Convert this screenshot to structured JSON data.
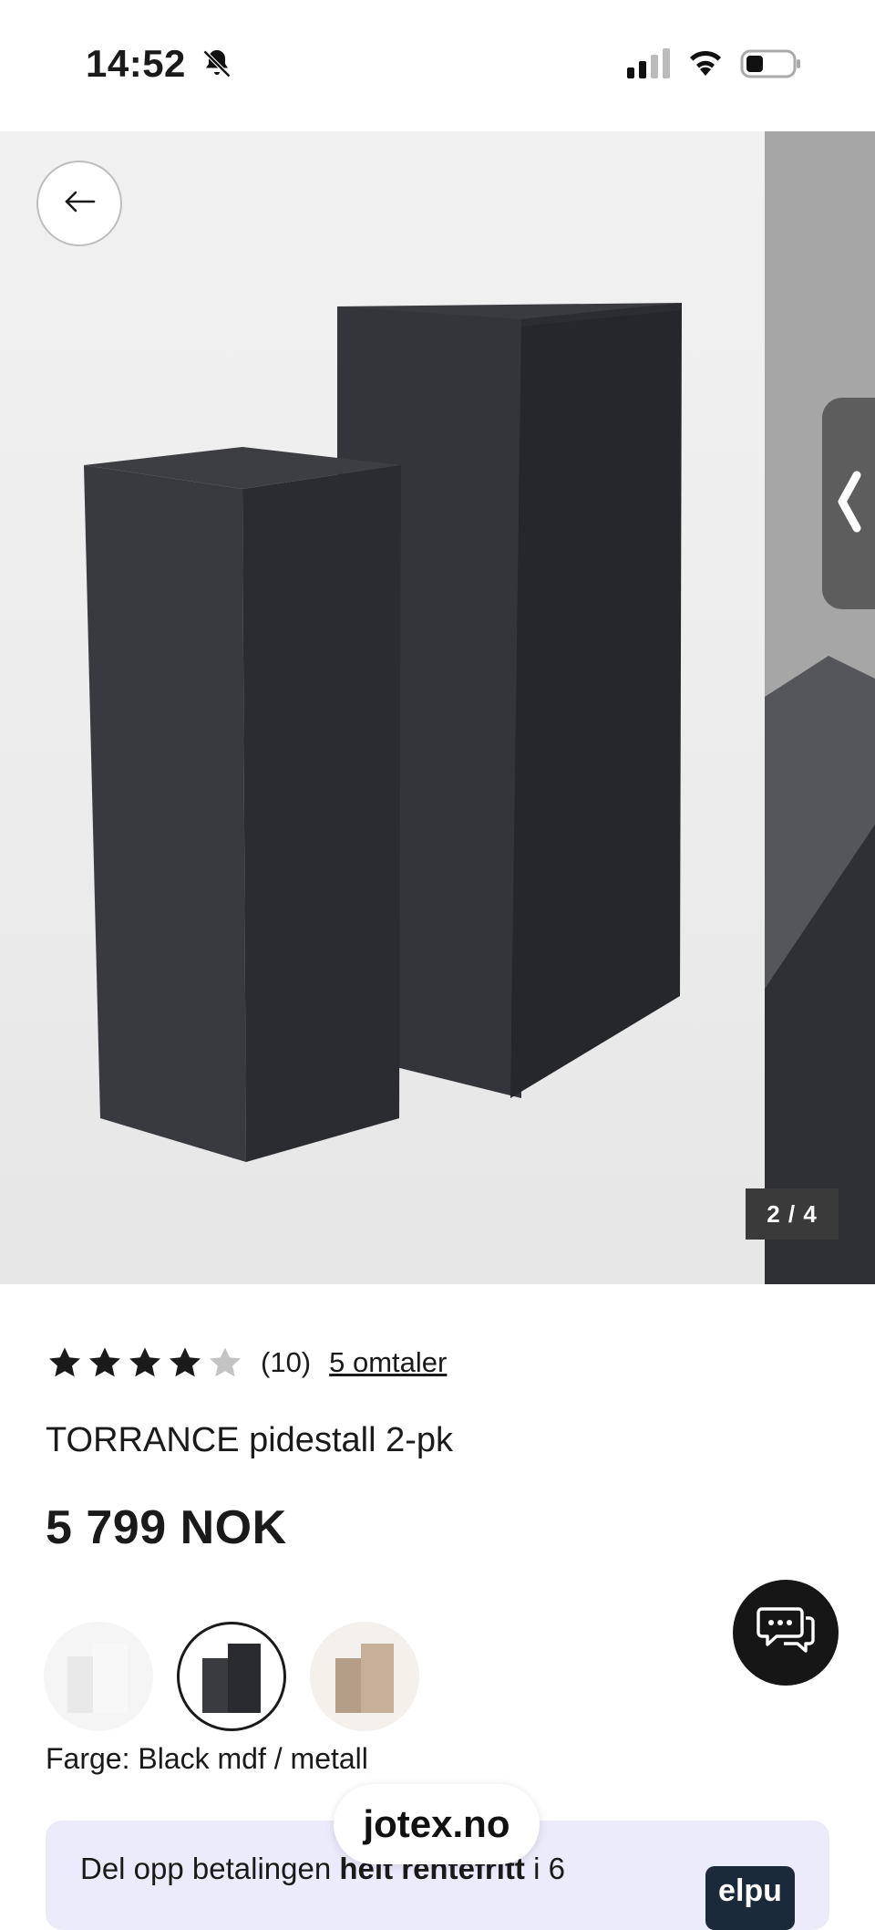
{
  "status_bar": {
    "time": "14:52",
    "icons": [
      "bell-slash-icon",
      "cellular-signal-icon",
      "wifi-icon",
      "battery-icon"
    ]
  },
  "gallery": {
    "counter": "2 / 4",
    "icons": [
      "arrow-left-icon",
      "chevron-left-icon"
    ]
  },
  "product": {
    "rating_stars": 4,
    "rating_max": 5,
    "rating_count": "(10)",
    "reviews_link": "5 omtaler",
    "title": "TORRANCE pidestall 2-pk",
    "price": "5 799 NOK",
    "color_label": "Farge: Black mdf / metall",
    "swatches": [
      "white",
      "black",
      "tan"
    ],
    "selected_swatch": "black"
  },
  "financing": {
    "text_prefix": "Del opp betalingen ",
    "text_bold": "helt rentefritt",
    "text_suffix": " i 6",
    "logo": "elpu"
  },
  "browser": {
    "url": "jotex.no"
  },
  "colors": {
    "star_filled": "#1a1a1a",
    "star_empty": "#c4c4c4",
    "financing_bg": "#ecebfb",
    "chat_bg": "#161616"
  }
}
